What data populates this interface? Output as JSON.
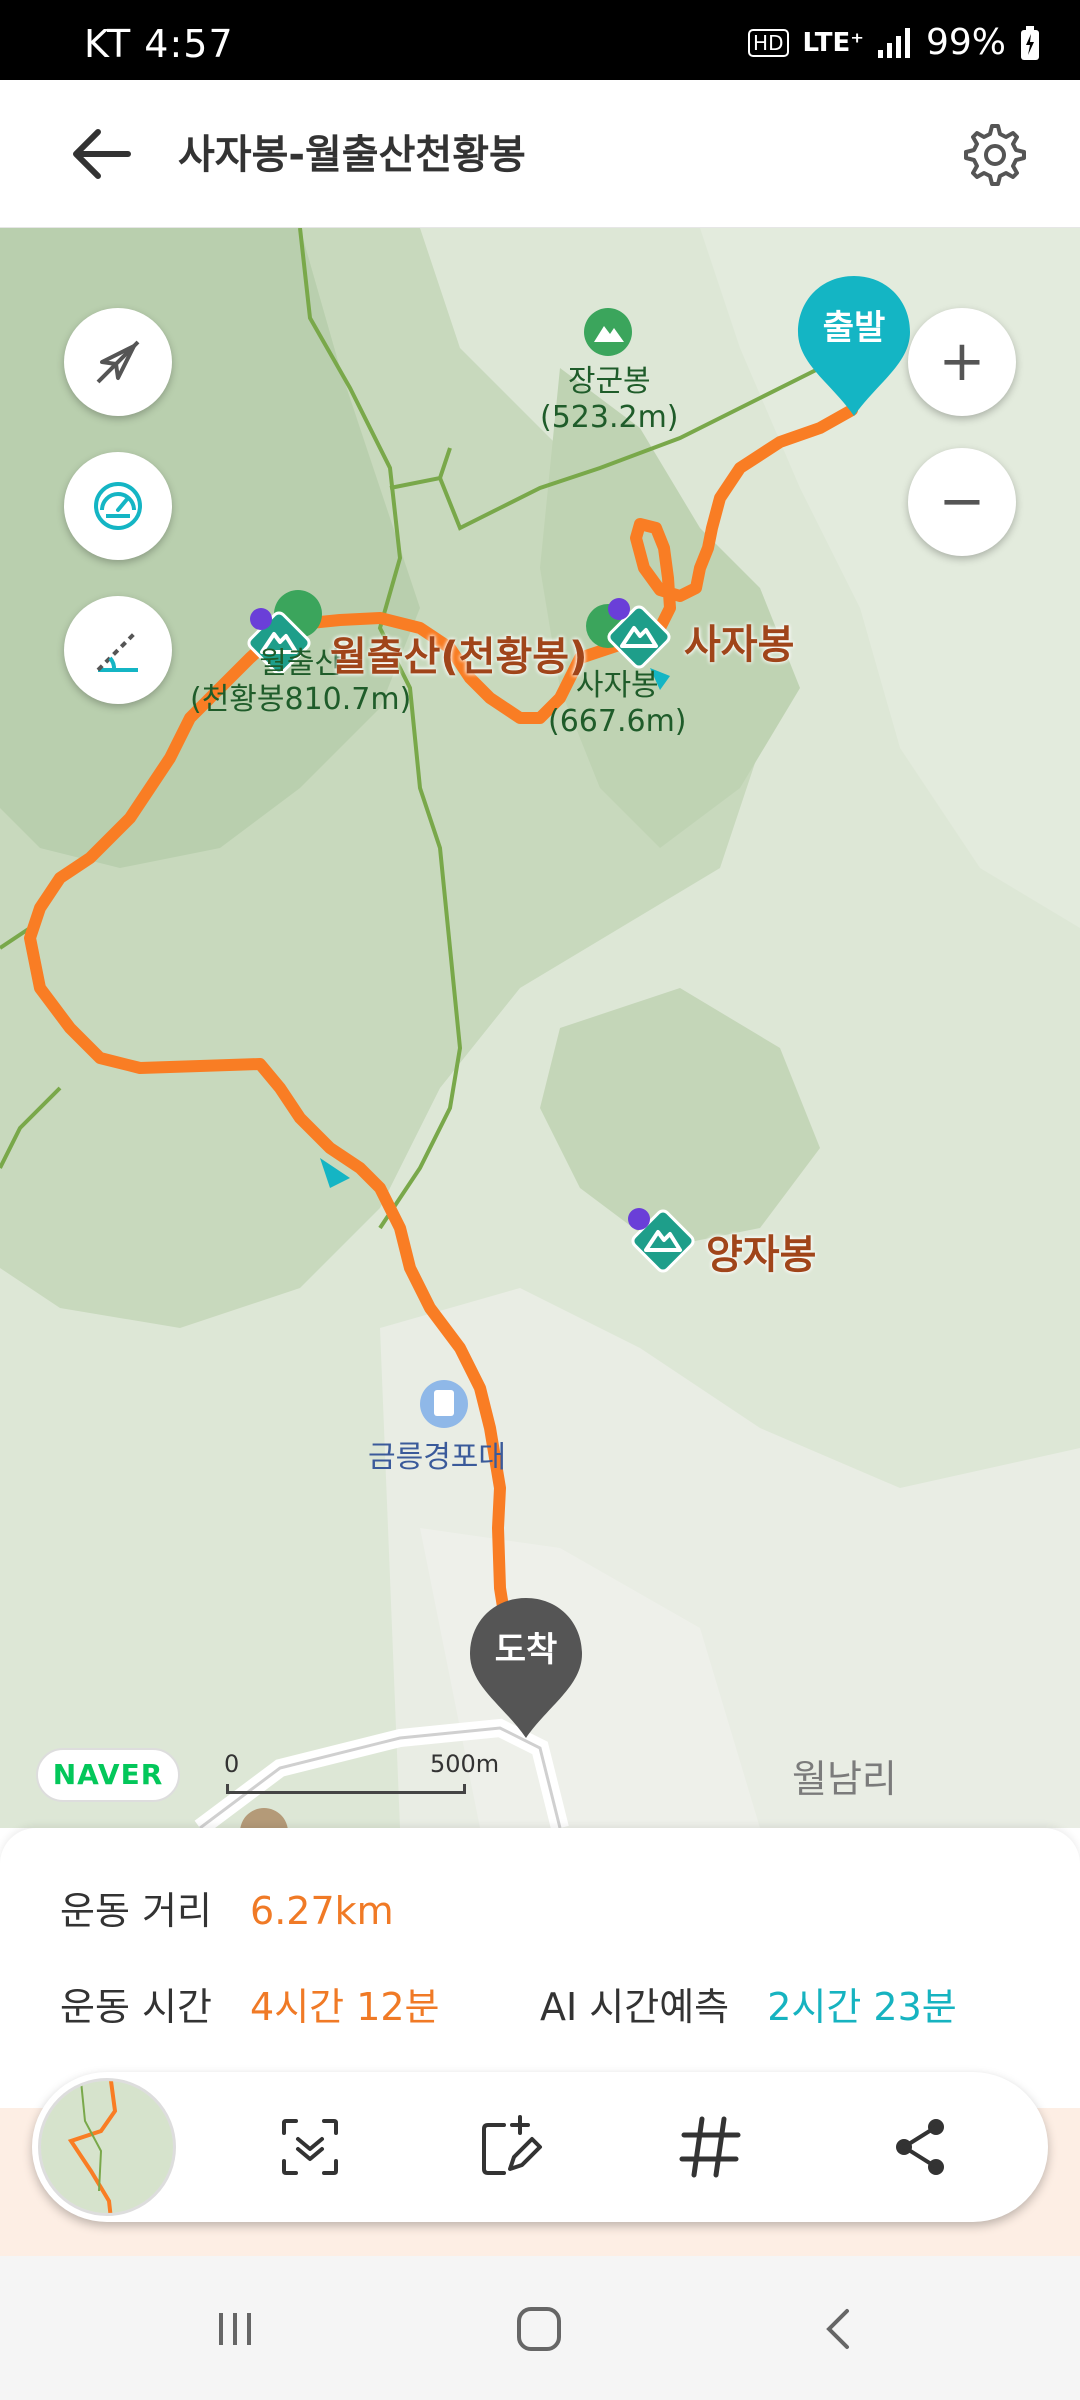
{
  "status_bar": {
    "carrier": "KT",
    "time": "4:57",
    "hd_badge": "HD",
    "network": "LTE⁺",
    "battery": "99%"
  },
  "app_bar": {
    "title": "사자봉-월출산천황봉",
    "back_icon": "arrow-left-icon",
    "settings_icon": "gear-icon"
  },
  "map": {
    "start_label": "출발",
    "end_label": "도착",
    "places": {
      "janggunbong_name": "장군봉",
      "janggunbong_height": "(523.2m)",
      "wolchul_big": "월출산(천황봉)",
      "wolchul_name": "월출산",
      "wolchul_height": "(천황봉810.7m)",
      "sajabong_big": "사자봉",
      "sajabong_name": "사자봉",
      "sajabong_height": "(667.6m)",
      "yangjabong": "양자봉",
      "geumneung": "금릉경포대",
      "village": "월남리"
    },
    "scale": {
      "start": "0",
      "end": "500m"
    },
    "provider": "NAVER",
    "zoom_in": "+",
    "zoom_out": "−",
    "accent_color": "#f97d24",
    "pin_start_color": "#14b5c4",
    "pin_end_color": "#555555"
  },
  "stats": {
    "distance_label": "운동 거리",
    "distance_value": "6.27km",
    "time_label": "운동 시간",
    "time_value": "4시간 12분",
    "ai_label": "AI 시간예측",
    "ai_value": "2시간 23분"
  },
  "toolbar": {
    "items": [
      "map-thumbnail",
      "scan-icon",
      "edit-post-icon",
      "hashtag-icon",
      "share-icon"
    ]
  }
}
